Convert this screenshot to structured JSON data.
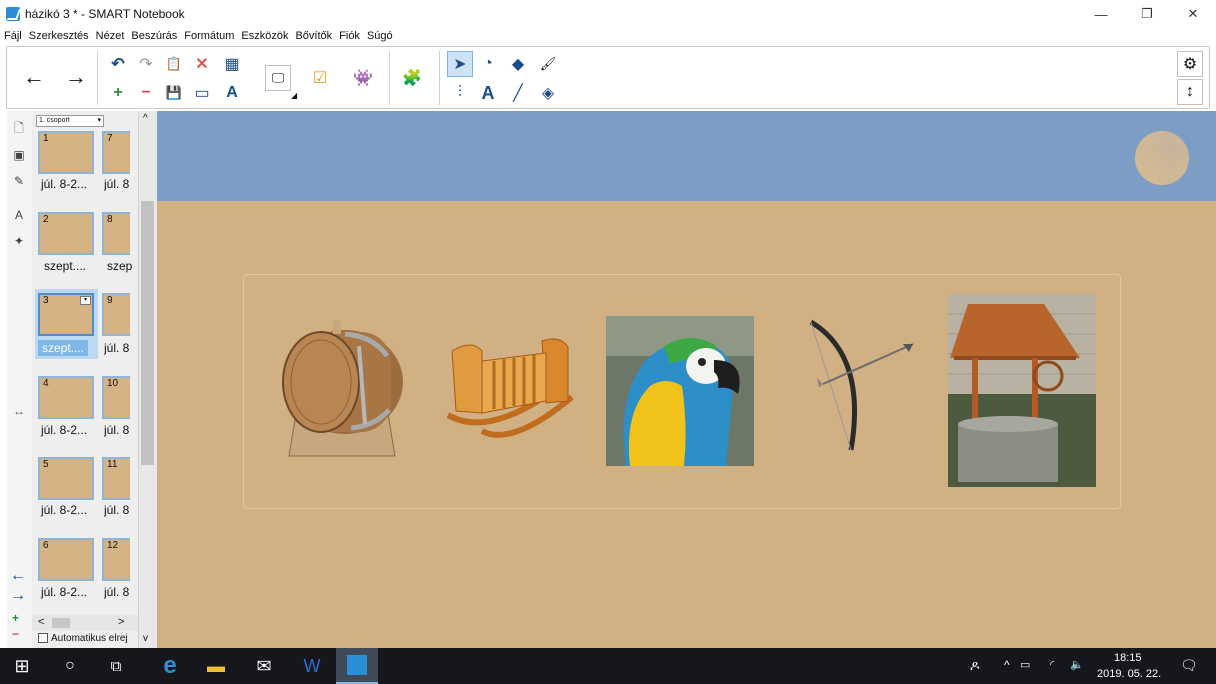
{
  "window": {
    "title": "házikó 3 * - SMART Notebook",
    "minimize": "—",
    "restore": "❐",
    "close": "✕"
  },
  "menu": [
    "Fájl",
    "Szerkesztés",
    "Nézet",
    "Beszúrás",
    "Formátum",
    "Eszközök",
    "Bővítők",
    "Fiók",
    "Súgó"
  ],
  "toolbar": {
    "back": "←",
    "forward": "→",
    "undo": "↶",
    "redo": "↷",
    "paste": "📋",
    "delete": "✕",
    "table": "▦",
    "add_page": "+",
    "delete_page": "−",
    "save": "💾",
    "screen_shade": "▭",
    "handwriting": "A",
    "display": "🖵",
    "response": "☑",
    "lab": "👾",
    "addons": "🧩",
    "select": "➤",
    "shapes": "◔",
    "fill": "◆",
    "magic_pen": "🖌",
    "measure": "⫶",
    "text": "A",
    "line": "╱",
    "eraser": "◈",
    "settings": "⚙",
    "move_toolbar": "↕",
    "dropdown_marker": "◢"
  },
  "sidebar": {
    "tabs": [
      "page-sorter",
      "gallery",
      "attachments",
      "properties",
      "addons"
    ],
    "group_select": "1. csoport",
    "auto_hide_label": "Automatikus elrej",
    "splitter_arrow": "↔",
    "nav_back": "←",
    "nav_forward": "→",
    "add_page": "+",
    "delete_page": "−",
    "scroll_up": "^",
    "scroll_down": "v",
    "scroll_left": "<",
    "scroll_right": ">",
    "pages": [
      {
        "num": "1",
        "label": "júl. 8-2..."
      },
      {
        "num": "7",
        "label": "júl. 8"
      },
      {
        "num": "2",
        "label": "szept...."
      },
      {
        "num": "8",
        "label": "szep"
      },
      {
        "num": "3",
        "label": "szept...."
      },
      {
        "num": "9",
        "label": "júl. 8"
      },
      {
        "num": "4",
        "label": "júl. 8-2..."
      },
      {
        "num": "10",
        "label": "júl. 8"
      },
      {
        "num": "5",
        "label": "júl. 8-2..."
      },
      {
        "num": "11",
        "label": "júl. 8"
      },
      {
        "num": "6",
        "label": "júl. 8-2..."
      },
      {
        "num": "12",
        "label": "júl. 8"
      }
    ]
  },
  "canvas": {
    "objects": [
      "barrel",
      "cradle",
      "parrot",
      "bow-and-arrow",
      "water-well"
    ]
  },
  "taskbar": {
    "time": "18:15",
    "date": "2019. 05. 22."
  },
  "colors": {
    "canvas_bg": "#d1b183",
    "canvas_top": "#7d9ec4",
    "selection": "#7fb7e6",
    "taskbar": "#16171c"
  }
}
